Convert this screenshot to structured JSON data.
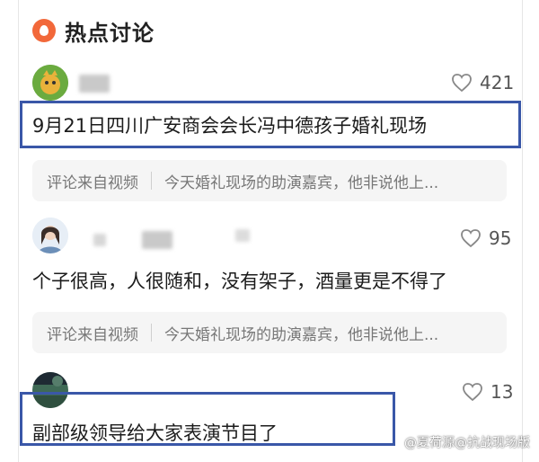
{
  "section": {
    "title": "热点讨论"
  },
  "comments": [
    {
      "likes": "421",
      "text": "9月21日四川广安商会会长冯中德孩子婚礼现场"
    },
    {
      "likes": "95",
      "text": "个子很高，人很随和，没有架子，酒量更是不得了"
    },
    {
      "likes": "13",
      "text": "副部级领导给大家表演节目了"
    }
  ],
  "source": {
    "label": "评论来自视频",
    "quote": "今天婚礼现场的助演嘉宾，他非说他上..."
  },
  "watermark": "@夏荷源@抗战现场版",
  "colors": {
    "accent_icon": "#f2683a",
    "highlight_border": "#3a57a8"
  },
  "icons": {
    "section": "fire-icon",
    "like": "heart-icon"
  }
}
